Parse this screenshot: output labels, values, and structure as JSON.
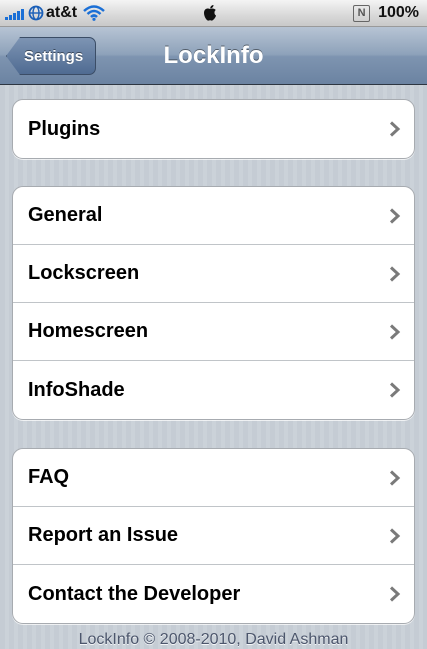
{
  "status_bar": {
    "carrier": "at&t",
    "battery": "100%",
    "notification_icon_letter": "N",
    "icons": [
      "signal-icon",
      "globe-icon",
      "wifi-icon",
      "apple-logo-icon",
      "notification-icon"
    ]
  },
  "nav": {
    "back_label": "Settings",
    "title": "LockInfo"
  },
  "groups": [
    {
      "rows": [
        {
          "label": "Plugins"
        }
      ]
    },
    {
      "rows": [
        {
          "label": "General"
        },
        {
          "label": "Lockscreen"
        },
        {
          "label": "Homescreen"
        },
        {
          "label": "InfoShade"
        }
      ]
    },
    {
      "rows": [
        {
          "label": "FAQ"
        },
        {
          "label": "Report an Issue"
        },
        {
          "label": "Contact the Developer"
        }
      ]
    }
  ],
  "footer": {
    "text": "LockInfo © 2008-2010, David Ashman"
  },
  "colors": {
    "accent_signal": "#1a6fd6",
    "navbar": "#6b83a2",
    "background": "#c5ccd4"
  }
}
